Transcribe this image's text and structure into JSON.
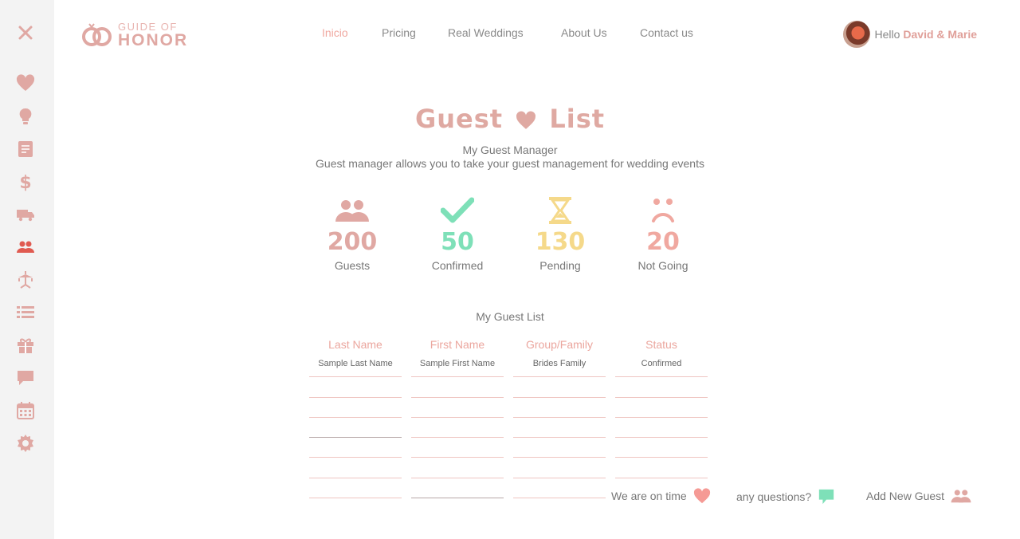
{
  "logo": {
    "line1": "GUIDE OF",
    "line2": "HONOR"
  },
  "nav": [
    {
      "label": "Inicio",
      "active": true
    },
    {
      "label": "Pricing",
      "active": false
    },
    {
      "label": "Real Weddings",
      "active": false
    },
    {
      "label": "About Us",
      "active": false
    },
    {
      "label": "Contact us",
      "active": false
    }
  ],
  "user": {
    "greeting": "Hello",
    "names": "David & Marie"
  },
  "page": {
    "title_left": "Guest",
    "title_right": "List",
    "subtitle": "My Guest Manager",
    "description": "Guest manager allows you to take your guest management for wedding events"
  },
  "stats": [
    {
      "value": "200",
      "label": "Guests",
      "color": "#e0a8a3",
      "icon": "guests-icon"
    },
    {
      "value": "50",
      "label": "Confirmed",
      "color": "#7ee0b8",
      "icon": "check-icon"
    },
    {
      "value": "130",
      "label": "Pending",
      "color": "#f5d98a",
      "icon": "hourglass-icon"
    },
    {
      "value": "20",
      "label": "Not Going",
      "color": "#f0a8a0",
      "icon": "sad-face-icon"
    }
  ],
  "table": {
    "title": "My Guest List",
    "columns": [
      "Last Name",
      "First Name",
      "Group/Family",
      "Status"
    ],
    "sample_row": [
      "Sample Last Name",
      "Sample First Name",
      "Brides Family",
      "Confirmed"
    ]
  },
  "footer": {
    "on_time": "We are on time",
    "questions": "any questions?",
    "add_guest": "Add New Guest"
  },
  "colors": {
    "accent": "#e0a8a3",
    "sidebar_bg": "#f3f3f3",
    "active_icon": "#e05a50"
  },
  "sidebar_icons": [
    "close-icon",
    "heart-icon",
    "lightbulb-icon",
    "document-icon",
    "dollar-icon",
    "truck-icon",
    "guests-icon",
    "cake-table-icon",
    "list-icon",
    "gift-icon",
    "chat-icon",
    "calendar-icon",
    "gear-icon"
  ]
}
